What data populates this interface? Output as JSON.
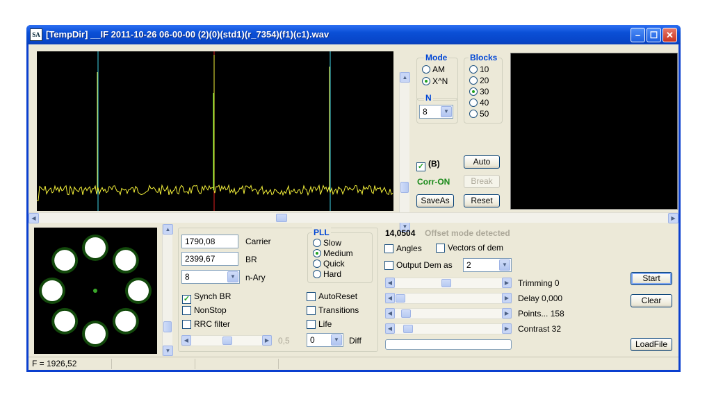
{
  "window": {
    "title": "[TempDir] __IF 2011-10-26 06-00-00 (2)(0)(std1)(r_7354)(f1)(c1).wav",
    "app_icon": "SA"
  },
  "icons": {
    "minimize": "minimize-icon",
    "maximize": "maximize-icon",
    "close": "close-icon"
  },
  "mode": {
    "title": "Mode",
    "options": [
      "AM",
      "X^N"
    ],
    "selected": "X^N"
  },
  "blocks": {
    "title": "Blocks",
    "options": [
      "10",
      "20",
      "30",
      "40",
      "50"
    ],
    "selected": "30"
  },
  "n": {
    "title": "N",
    "value": "8"
  },
  "top_controls": {
    "b_label": "(B)",
    "b_checked": true,
    "auto": "Auto",
    "corr_on": "Corr-ON",
    "break": "Break",
    "saveas": "SaveAs",
    "reset": "Reset"
  },
  "params": {
    "carrier_value": "1790,08",
    "carrier_label": "Carrier",
    "br_value": "2399,67",
    "br_label": "BR",
    "nary_value": "8",
    "nary_label": "n-Ary"
  },
  "pll": {
    "title": "PLL",
    "options": [
      "Slow",
      "Medium",
      "Quick",
      "Hard"
    ],
    "selected": "Medium"
  },
  "options_left": [
    {
      "label": "Synch BR",
      "checked": true
    },
    {
      "label": "NonStop",
      "checked": false
    },
    {
      "label": "RRC filter",
      "checked": false
    }
  ],
  "options_right": [
    {
      "label": "AutoReset",
      "checked": false
    },
    {
      "label": "Transitions",
      "checked": false
    },
    {
      "label": "Life",
      "checked": false
    }
  ],
  "slider_value": "0,5",
  "diff": {
    "value": "0",
    "label": "Diff"
  },
  "info": {
    "offset_value": "14,0504",
    "offset_text": "Offset mode detected"
  },
  "dem": {
    "angles": "Angles",
    "vectors": "Vectors of dem",
    "output": "Output Dem as",
    "output_value": "2"
  },
  "sliders": [
    {
      "label": "Trimming 0",
      "level": 0.48
    },
    {
      "label": "Delay  0,000",
      "level": 0.0
    },
    {
      "label": "Points... 158",
      "level": 0.06
    },
    {
      "label": "Contrast 32",
      "level": 0.08
    }
  ],
  "right_buttons": {
    "start": "Start",
    "clear": "Clear",
    "loadfile": "LoadFile"
  },
  "status": {
    "freq": "F = 1926,52"
  },
  "colors": {
    "spectrum_trace": "#f5f23a",
    "marker_cyan": "#3fd3e8",
    "marker_red": "#e02020",
    "constellation": "#7cff3a"
  }
}
